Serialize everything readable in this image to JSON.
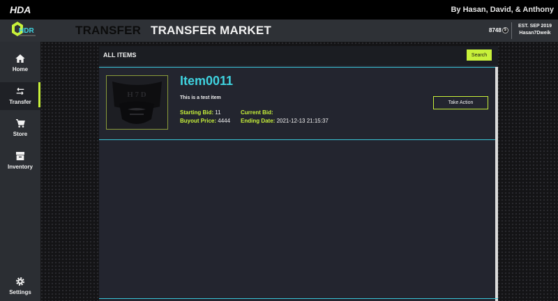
{
  "titlebar": {
    "app_name": "HDA",
    "credits": "By Hasan, David, & Anthony"
  },
  "header": {
    "logo_text": "HDR",
    "section_bold": "TRANSFER",
    "section_title": "TRANSFER MARKET",
    "coin_balance": "8748",
    "coin_symbol": "$",
    "est_label": "EST. SEP 2019",
    "username": "Hasan7Dweik"
  },
  "sidebar": {
    "items": [
      {
        "label": "Home",
        "icon": "home-icon"
      },
      {
        "label": "Transfer",
        "icon": "transfer-icon",
        "active": true
      },
      {
        "label": "Store",
        "icon": "cart-icon"
      },
      {
        "label": "Inventory",
        "icon": "inventory-icon"
      },
      {
        "label": "Settings",
        "icon": "gear-icon"
      }
    ]
  },
  "panel": {
    "title": "ALL ITEMS",
    "search_label": "Search"
  },
  "items": [
    {
      "name": "Item0011",
      "description": "This is a test item",
      "starting_bid_label": "Starting Bid:",
      "starting_bid": "11",
      "buyout_label": "Buyout Price:",
      "buyout": "4444",
      "current_bid_label": "Current Bid:",
      "current_bid": "",
      "ending_date_label": "Ending Date:",
      "ending_date": "2021-12-13 21:15:37",
      "action_label": "Take Action",
      "image_letters": "H 7 D"
    }
  ],
  "colors": {
    "accent": "#c8f13a",
    "cyan": "#3fd3e0",
    "panel": "#23252f",
    "sidebar": "#2b2e33"
  }
}
